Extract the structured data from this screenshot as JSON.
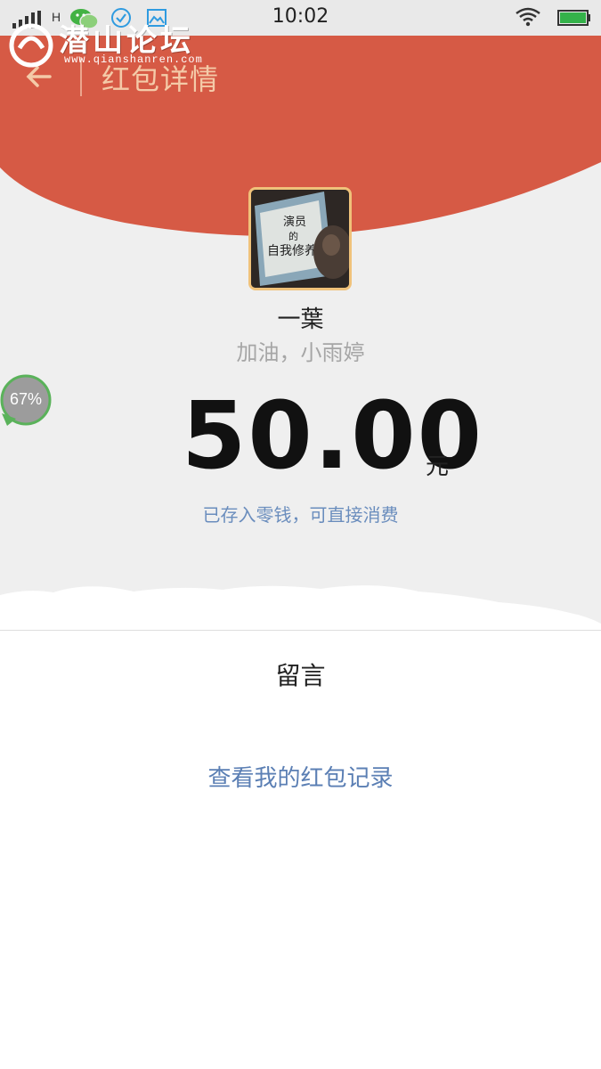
{
  "status_bar": {
    "time": "10:02",
    "network_type": "H",
    "icons": [
      "signal-icon",
      "wechat-icon",
      "check-circle-icon",
      "gallery-icon",
      "wifi-icon",
      "battery-icon"
    ]
  },
  "watermark": {
    "text": "潜山论坛",
    "url": "www.qianshanren.com"
  },
  "header": {
    "title": "红包详情",
    "back_icon": "arrow-left-icon",
    "colors": {
      "header_red": "#d65a45",
      "title": "#f4caa8",
      "page_bg": "#efefef"
    }
  },
  "red_packet": {
    "sender_name": "一葉",
    "blessing": "加油，小雨婷",
    "amount": "50.00",
    "currency": "元",
    "deposit_note": "已存入零钱，可直接消费",
    "avatar_book": {
      "line1": "演员",
      "line2": "的",
      "line3": "自我修养"
    }
  },
  "float_badge": {
    "text": "67%"
  },
  "message_section": {
    "heading": "留言",
    "history_link": "查看我的红包记录"
  }
}
